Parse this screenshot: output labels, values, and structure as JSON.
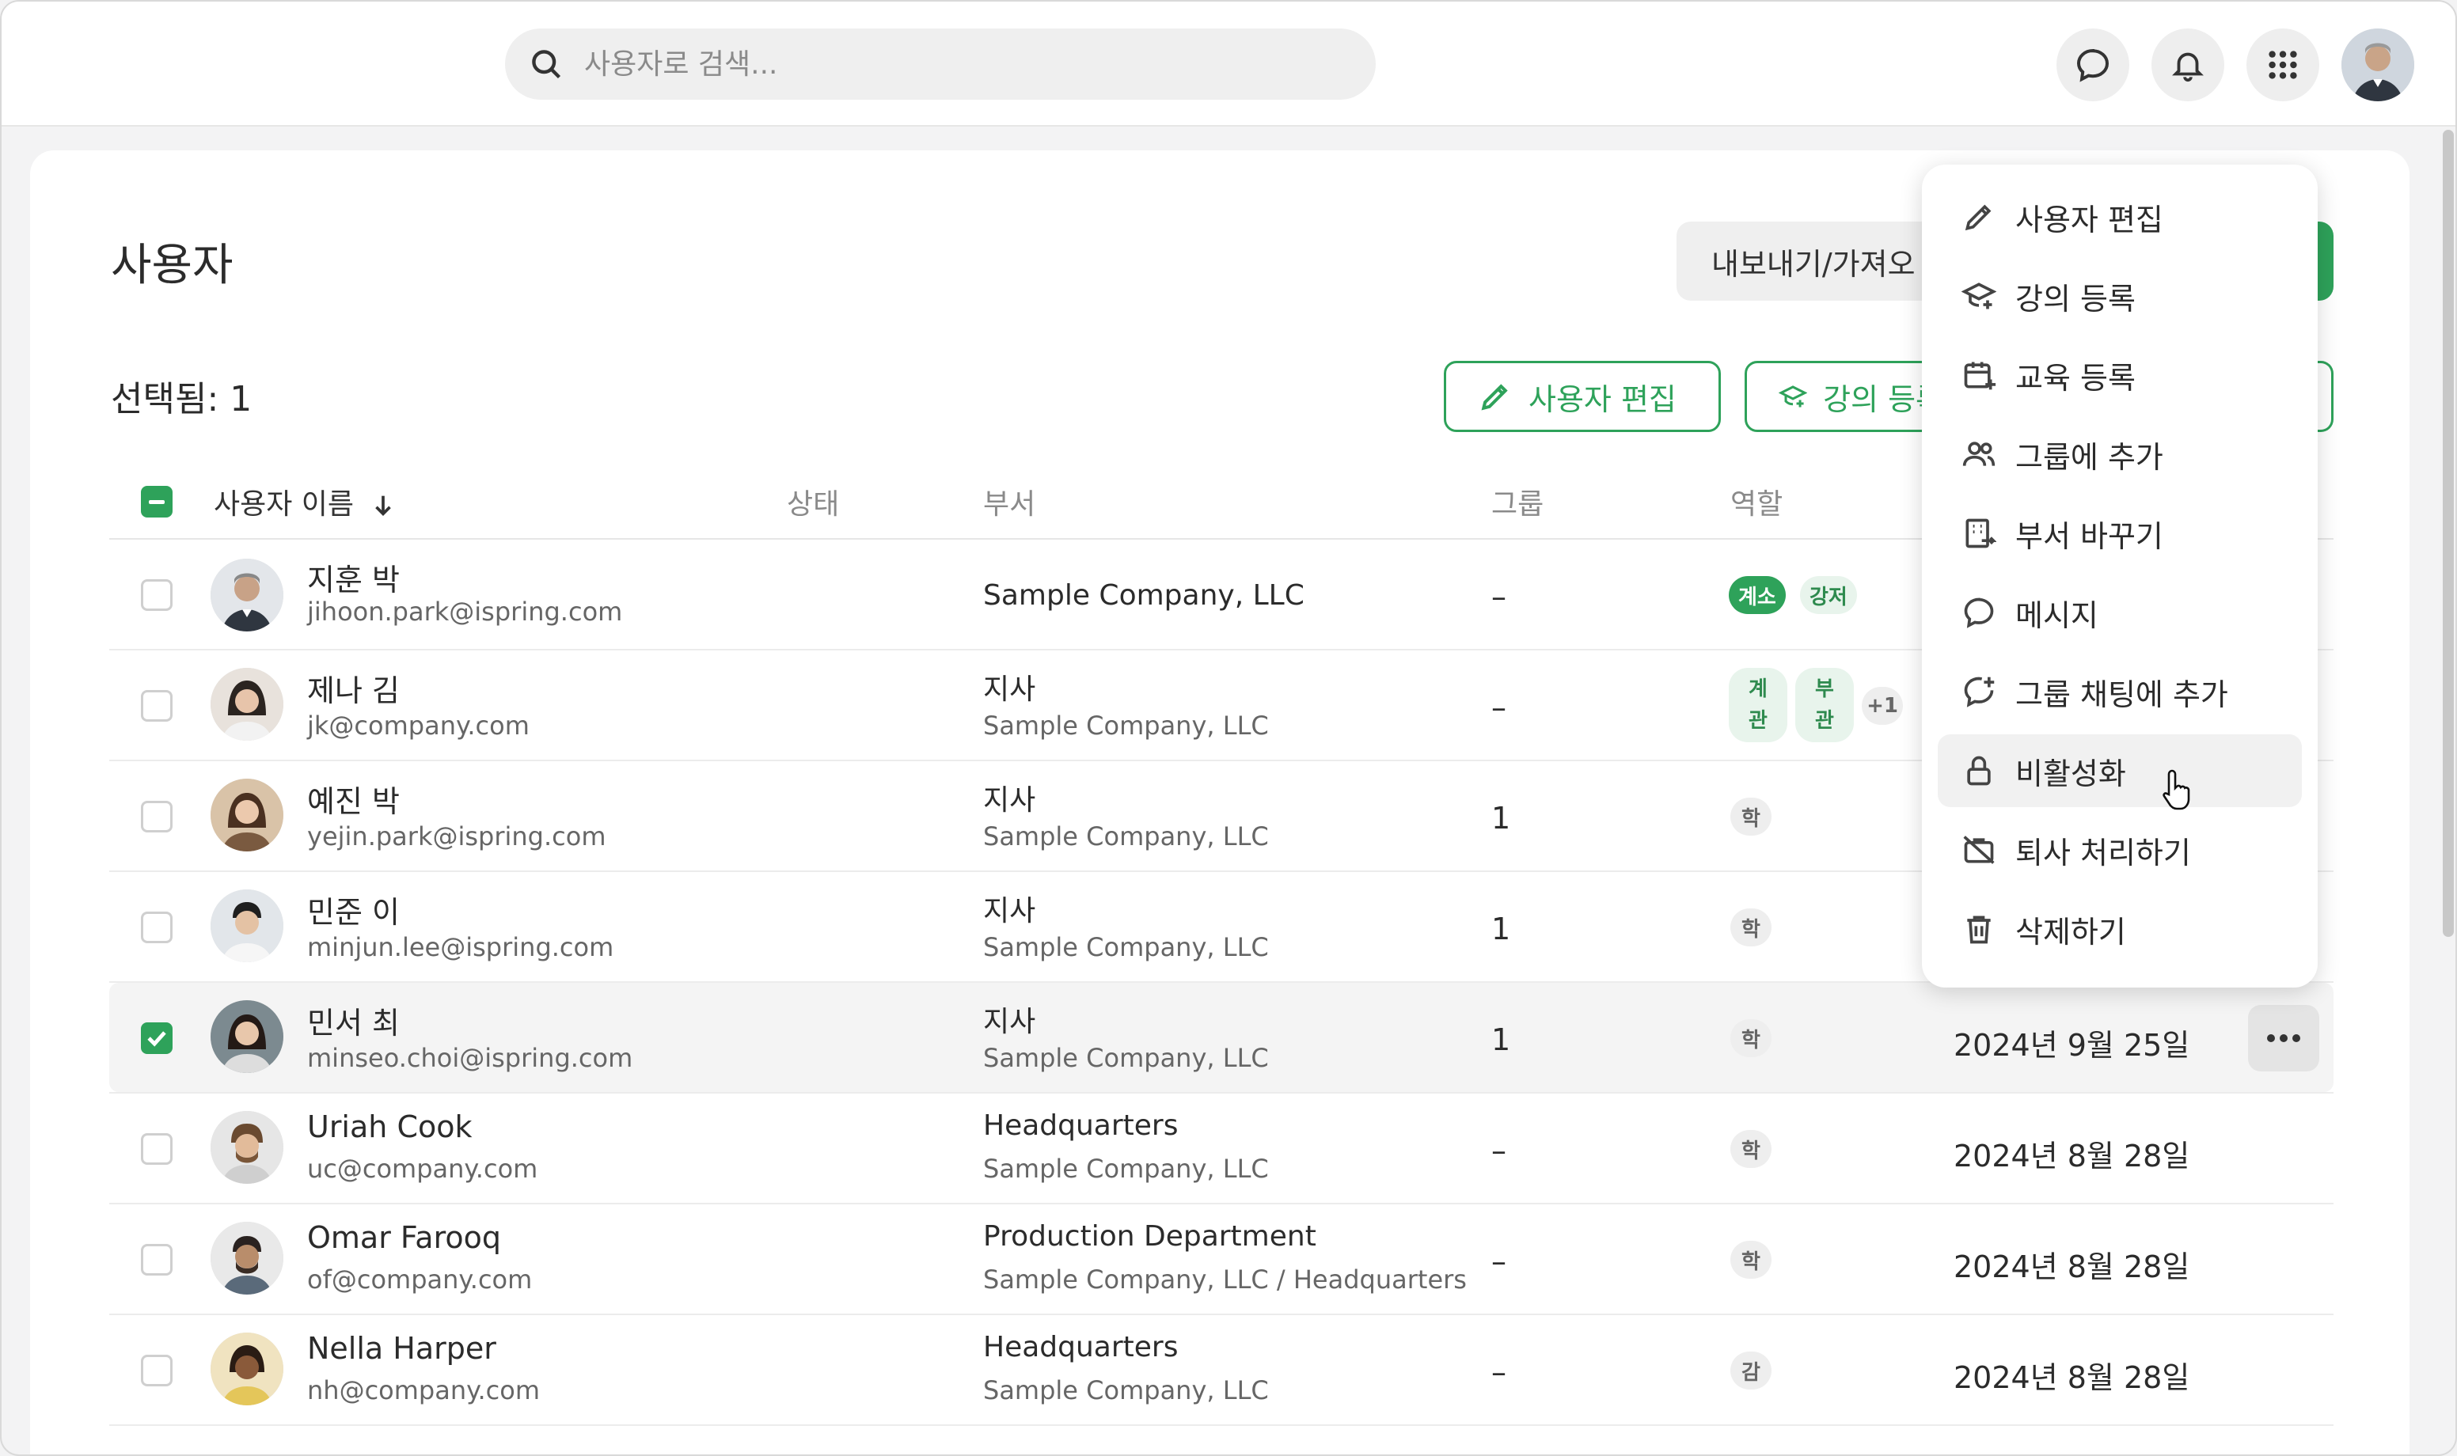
{
  "topbar": {
    "search_placeholder": "사용자로 검색...",
    "icons": [
      "search-icon",
      "chat-icon",
      "bell-icon",
      "apps-grid-icon",
      "user-avatar"
    ]
  },
  "page": {
    "title": "사용자",
    "export_label": "내보내기/가져오",
    "selected_label": "선택됨: 1",
    "actions": {
      "edit_user": "사용자 편집",
      "enroll_course": "강의 등록"
    }
  },
  "table": {
    "headers": {
      "name": "사용자 이름",
      "status": "상태",
      "department": "부서",
      "group": "그룹",
      "role": "역할"
    },
    "rows": [
      {
        "name": "지훈 박",
        "email": "jihoon.park@ispring.com",
        "dept": "Sample Company, LLC",
        "dept_sub": "",
        "group": "–",
        "roles": [
          "계소",
          "강저"
        ],
        "date": "",
        "checked": false
      },
      {
        "name": "제나 김",
        "email": "jk@company.com",
        "dept": "지사",
        "dept_sub": "Sample Company, LLC",
        "group": "–",
        "roles": [
          "계관",
          "부관",
          "+1"
        ],
        "date": "",
        "checked": false
      },
      {
        "name": "예진 박",
        "email": "yejin.park@ispring.com",
        "dept": "지사",
        "dept_sub": "Sample Company, LLC",
        "group": "1",
        "roles": [
          "학"
        ],
        "date": "",
        "checked": false
      },
      {
        "name": "민준 이",
        "email": "minjun.lee@ispring.com",
        "dept": "지사",
        "dept_sub": "Sample Company, LLC",
        "group": "1",
        "roles": [
          "학"
        ],
        "date": "",
        "checked": false
      },
      {
        "name": "민서 최",
        "email": "minseo.choi@ispring.com",
        "dept": "지사",
        "dept_sub": "Sample Company, LLC",
        "group": "1",
        "roles": [
          "학"
        ],
        "date": "2024년 9월 25일",
        "checked": true
      },
      {
        "name": "Uriah Cook",
        "email": "uc@company.com",
        "dept": "Headquarters",
        "dept_sub": "Sample Company, LLC",
        "group": "–",
        "roles": [
          "학"
        ],
        "date": "2024년 8월 28일",
        "checked": false
      },
      {
        "name": "Omar Farooq",
        "email": "of@company.com",
        "dept": "Production Department",
        "dept_sub": "Sample Company, LLC / Headquarters",
        "group": "–",
        "roles": [
          "학"
        ],
        "date": "2024년 8월 28일",
        "checked": false
      },
      {
        "name": "Nella Harper",
        "email": "nh@company.com",
        "dept": "Headquarters",
        "dept_sub": "Sample Company, LLC",
        "group": "–",
        "roles": [
          "감"
        ],
        "date": "2024년 8월 28일",
        "checked": false
      }
    ]
  },
  "menu": {
    "items": [
      {
        "label": "사용자 편집",
        "icon": "pencil-icon"
      },
      {
        "label": "강의 등록",
        "icon": "graduation-cap-plus-icon"
      },
      {
        "label": "교육 등록",
        "icon": "calendar-plus-icon"
      },
      {
        "label": "그룹에 추가",
        "icon": "users-icon"
      },
      {
        "label": "부서 바꾸기",
        "icon": "building-swap-icon"
      },
      {
        "label": "메시지",
        "icon": "chat-bubble-icon"
      },
      {
        "label": "그룹 채팅에 추가",
        "icon": "chat-plus-icon"
      },
      {
        "label": "비활성화",
        "icon": "lock-icon"
      },
      {
        "label": "퇴사 처리하기",
        "icon": "briefcase-off-icon"
      },
      {
        "label": "삭제하기",
        "icon": "trash-icon"
      }
    ],
    "hovered": "비활성화"
  },
  "colors": {
    "accent": "#2ea25a",
    "badge_bg": "#e8f4ec",
    "badge_text": "#2e8a4e"
  }
}
